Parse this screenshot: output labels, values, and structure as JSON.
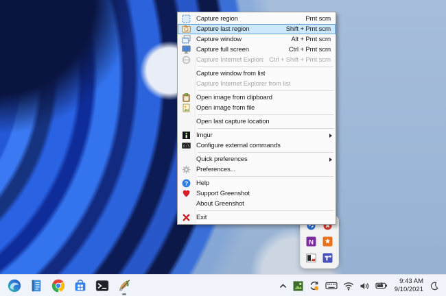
{
  "app": "Greenshot context menu on Windows 11 desktop",
  "colors": {
    "menu_bg": "#fbfbfb",
    "menu_border": "#9d9d9d",
    "highlight_fill": "#cde8fa",
    "highlight_border": "#5f9fd8",
    "disabled_text": "#a9a9a9",
    "taskbar_bg": "#f0f4fa",
    "wallpaper_base": "#9db7d6",
    "wallpaper_blue": "#2a62e4",
    "wallpaper_navy": "#0a1547"
  },
  "menu": {
    "items": [
      {
        "name": "capture-region",
        "label": "Capture region",
        "shortcut": "Prnt scrn",
        "icon": "capture-region-icon",
        "state": "normal"
      },
      {
        "name": "capture-last-region",
        "label": "Capture last region",
        "shortcut": "Shift + Prnt scrn",
        "icon": "capture-last-region-icon",
        "state": "highlighted"
      },
      {
        "name": "capture-window",
        "label": "Capture window",
        "shortcut": "Alt + Prnt scrn",
        "icon": "capture-window-icon",
        "state": "normal"
      },
      {
        "name": "capture-full-screen",
        "label": "Capture full screen",
        "shortcut": "Ctrl + Prnt scrn",
        "icon": "capture-full-screen-icon",
        "state": "normal"
      },
      {
        "name": "capture-internet-explorer",
        "label": "Capture Internet Explorer",
        "shortcut": "Ctrl + Shift + Prnt scrn",
        "icon": "ie-icon",
        "state": "disabled",
        "separator_after": true
      },
      {
        "name": "capture-window-from-list",
        "label": "Capture window from list",
        "state": "normal"
      },
      {
        "name": "capture-ie-from-list",
        "label": "Capture Internet Explorer from list",
        "state": "disabled",
        "separator_after": true
      },
      {
        "name": "open-image-from-clipboard",
        "label": "Open image from clipboard",
        "icon": "clipboard-icon",
        "state": "normal"
      },
      {
        "name": "open-image-from-file",
        "label": "Open image from file",
        "icon": "image-file-icon",
        "state": "normal",
        "separator_after": true
      },
      {
        "name": "open-last-capture-location",
        "label": "Open last capture location",
        "state": "normal",
        "separator_after": true
      },
      {
        "name": "imgur",
        "label": "Imgur",
        "icon": "imgur-icon",
        "state": "normal",
        "submenu": true
      },
      {
        "name": "configure-external-commands",
        "label": "Configure external commands",
        "icon": "cmd-icon",
        "state": "normal",
        "separator_after": true
      },
      {
        "name": "quick-preferences",
        "label": "Quick preferences",
        "state": "normal",
        "submenu": true
      },
      {
        "name": "preferences",
        "label": "Preferences...",
        "icon": "gear-icon",
        "state": "normal",
        "separator_after": true
      },
      {
        "name": "help",
        "label": "Help",
        "icon": "help-icon",
        "state": "normal"
      },
      {
        "name": "support-greenshot",
        "label": "Support Greenshot",
        "icon": "heart-icon",
        "state": "normal"
      },
      {
        "name": "about-greenshot",
        "label": "About Greenshot",
        "state": "normal",
        "separator_after": true
      },
      {
        "name": "exit",
        "label": "Exit",
        "icon": "exit-icon",
        "state": "normal"
      }
    ]
  },
  "tray_popup": {
    "icons": [
      {
        "name": "blue-app-icon"
      },
      {
        "name": "error-badge-icon"
      },
      {
        "name": "onenote-icon"
      },
      {
        "name": "orange-app-icon"
      },
      {
        "name": "photo-app-icon"
      },
      {
        "name": "teams-icon"
      }
    ]
  },
  "taskbar": {
    "apps": [
      {
        "name": "edge",
        "icon": "edge-icon",
        "active": false
      },
      {
        "name": "notepad",
        "icon": "notepad-icon",
        "active": false
      },
      {
        "name": "chrome",
        "icon": "chrome-icon",
        "active": false
      },
      {
        "name": "store",
        "icon": "store-icon",
        "active": false
      },
      {
        "name": "terminal",
        "icon": "terminal-icon",
        "active": false
      },
      {
        "name": "greenshot",
        "icon": "greenshot-icon",
        "active": true
      }
    ],
    "tray": [
      {
        "name": "tray-chevron-up",
        "icon": "chevron-up-icon"
      },
      {
        "name": "tray-greenshot",
        "icon": "greenshot-tray-icon"
      },
      {
        "name": "tray-sync",
        "icon": "sync-icon"
      },
      {
        "name": "tray-touch-keyboard",
        "icon": "keyboard-icon"
      },
      {
        "name": "tray-wifi",
        "icon": "wifi-icon"
      },
      {
        "name": "tray-volume",
        "icon": "volume-icon"
      },
      {
        "name": "tray-battery",
        "icon": "battery-icon"
      }
    ],
    "clock": {
      "time": "9:43 AM",
      "date": "9/10/2021"
    },
    "focus_assist_icon": "moon-icon"
  }
}
